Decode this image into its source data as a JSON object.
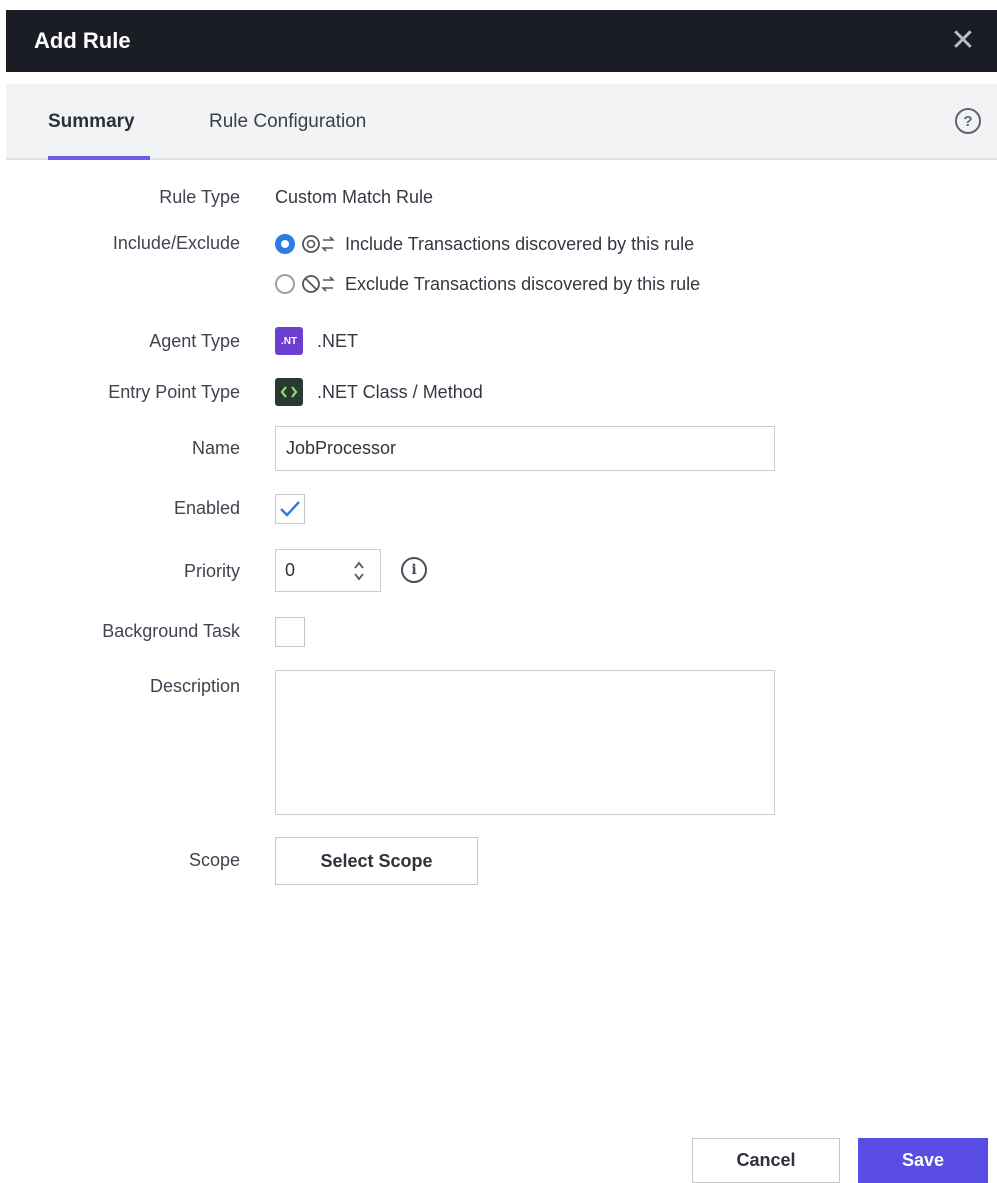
{
  "dialog": {
    "title": "Add Rule",
    "close_icon": "close-icon"
  },
  "tabs": [
    {
      "label": "Summary",
      "active": true
    },
    {
      "label": "Rule Configuration",
      "active": false
    }
  ],
  "help_icon": "help-circle-icon",
  "form": {
    "rule_type": {
      "label": "Rule Type",
      "value": "Custom Match Rule"
    },
    "include_exclude": {
      "label": "Include/Exclude",
      "options": [
        {
          "text": "Include Transactions discovered by this rule",
          "selected": true,
          "icon": "include-transactions-icon"
        },
        {
          "text": "Exclude Transactions discovered by this rule",
          "selected": false,
          "icon": "exclude-transactions-icon"
        }
      ]
    },
    "agent_type": {
      "label": "Agent Type",
      "badge": ".NT",
      "value": ".NET"
    },
    "entry_point_type": {
      "label": "Entry Point Type",
      "badge": "<>",
      "value": ".NET Class / Method"
    },
    "name": {
      "label": "Name",
      "value": "JobProcessor"
    },
    "enabled": {
      "label": "Enabled",
      "checked": true
    },
    "priority": {
      "label": "Priority",
      "value": "0"
    },
    "background_task": {
      "label": "Background Task",
      "checked": false
    },
    "description": {
      "label": "Description",
      "value": ""
    },
    "scope": {
      "label": "Scope",
      "button": "Select Scope"
    }
  },
  "footer": {
    "cancel": "Cancel",
    "save": "Save"
  },
  "colors": {
    "titlebar": "#1a1d24",
    "accent": "#5a4de6",
    "tab_underline": "#6b5ee6",
    "radio_selected": "#2f7be5",
    "checkmark": "#2f7be5",
    "net_badge": "#6a3fd1",
    "code_badge": "#2b3a30"
  }
}
